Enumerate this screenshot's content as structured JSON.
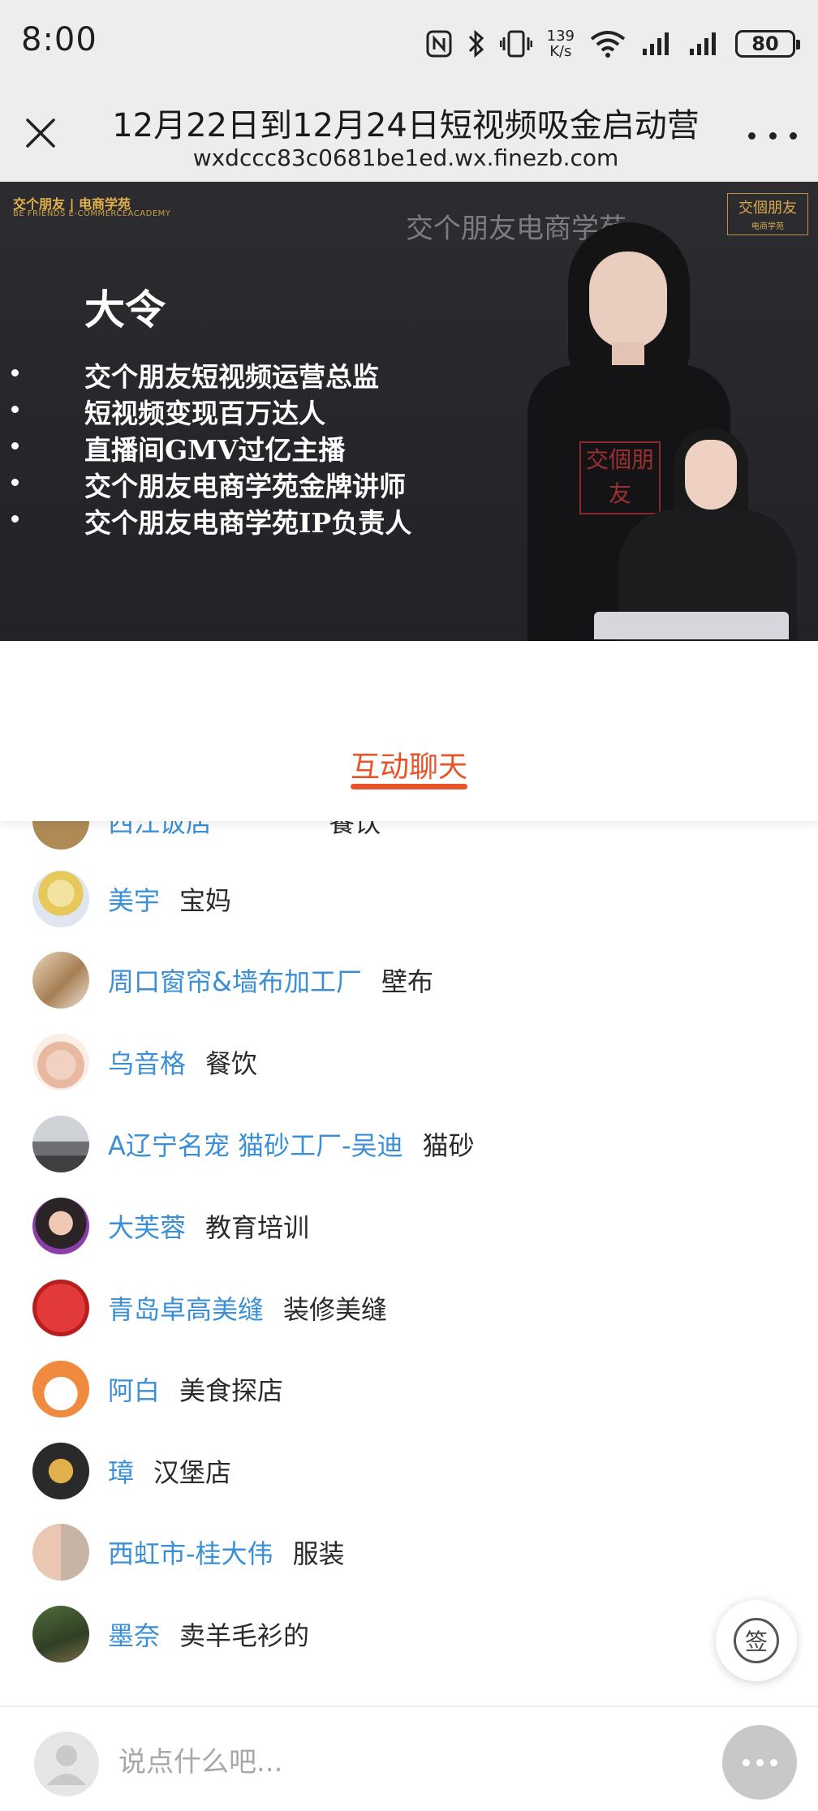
{
  "status_bar": {
    "time": "8:00",
    "net_speed_value": "139",
    "net_speed_unit": "K/s",
    "battery": "80",
    "icons": [
      "nfc-icon",
      "bluetooth-icon",
      "vibrate-icon",
      "wifi-icon",
      "signal-icon",
      "signal-icon",
      "battery-icon"
    ]
  },
  "browser": {
    "title": "12月22日到12月24日短视频吸金启动营",
    "url": "wxdccc83c0681be1ed.wx.finezb.com"
  },
  "video": {
    "brand_top_left": "交个朋友 | 电商学苑",
    "brand_top_left_sub": "BE FRIENDS E-COMMERCEACADEMY",
    "brand_top_right": "交個朋友",
    "brand_top_right_sub": "电商学苑",
    "watermark": "交个朋友电商学苑",
    "speaker_name": "大令",
    "bullets": [
      "交个朋友短视频运营总监",
      "短视频变现百万达人",
      "直播间GMV过亿主播",
      "交个朋友电商学苑金牌讲师",
      "交个朋友电商学苑IP负责人"
    ],
    "shirt_logo": "交個朋友"
  },
  "tabs": {
    "chat_label": "互动聊天"
  },
  "chat": [
    {
      "nick": "西江饭店",
      "msg": "餐饮"
    },
    {
      "nick": "美宇",
      "msg": "宝妈"
    },
    {
      "nick": "周口窗帘&墙布加工厂",
      "msg": "壁布"
    },
    {
      "nick": "乌音格",
      "msg": "餐饮"
    },
    {
      "nick": "A辽宁名宠 猫砂工厂-吴迪",
      "msg": "猫砂"
    },
    {
      "nick": "大芙蓉",
      "msg": "教育培训"
    },
    {
      "nick": "青岛卓高美缝",
      "msg": "装修美缝"
    },
    {
      "nick": "阿白",
      "msg": "美食探店"
    },
    {
      "nick": "璋",
      "msg": "汉堡店"
    },
    {
      "nick": "西虹市-桂大伟",
      "msg": "服装"
    },
    {
      "nick": "墨奈",
      "msg": "卖羊毛衫的"
    }
  ],
  "sign_button": "签",
  "input": {
    "placeholder": "说点什么吧..."
  },
  "colors": {
    "accent": "#e8532a",
    "nick": "#3a8fd6",
    "chrome": "#ededed"
  }
}
